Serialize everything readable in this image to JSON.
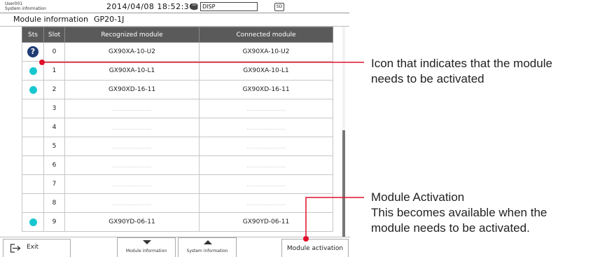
{
  "status_bar": {
    "user": "User001",
    "system_info": "System information",
    "datetime": "2014/04/08  18:52:36",
    "disp": "DISP",
    "sd": "SD"
  },
  "page": {
    "title": "Module information",
    "model": "GP20-1J"
  },
  "table": {
    "headers": {
      "sts": "Sts",
      "slot": "Slot",
      "recognized": "Recognized module",
      "connected": "Connected module"
    },
    "rows": [
      {
        "status": "question",
        "slot": "0",
        "recognized": "GX90XA-10-U2",
        "connected": "GX90XA-10-U2"
      },
      {
        "status": "ok",
        "slot": "1",
        "recognized": "GX90XA-10-L1",
        "connected": "GX90XA-10-L1"
      },
      {
        "status": "ok",
        "slot": "2",
        "recognized": "GX90XD-16-11",
        "connected": "GX90XD-16-11"
      },
      {
        "status": "none",
        "slot": "3",
        "recognized": "…………………",
        "connected": "…………………"
      },
      {
        "status": "none",
        "slot": "4",
        "recognized": "…………………",
        "connected": "…………………"
      },
      {
        "status": "none",
        "slot": "5",
        "recognized": "…………………",
        "connected": "…………………"
      },
      {
        "status": "none",
        "slot": "6",
        "recognized": "…………………",
        "connected": "…………………"
      },
      {
        "status": "none",
        "slot": "7",
        "recognized": "…………………",
        "connected": "…………………"
      },
      {
        "status": "none",
        "slot": "8",
        "recognized": "…………………",
        "connected": "…………………"
      },
      {
        "status": "ok",
        "slot": "9",
        "recognized": "GX90YD-06-11",
        "connected": "GX90YD-06-11"
      }
    ]
  },
  "bottom_bar": {
    "exit_label": "Exit",
    "module_info_label": "Module information",
    "system_info_label": "System information",
    "module_activation_label": "Module activation"
  },
  "annotations": {
    "icon_callout": [
      "Icon that indicates that the module",
      "needs to be activated"
    ],
    "activation_callout": [
      "Module Activation",
      "This becomes available when the",
      "module needs to be activated."
    ]
  },
  "colors": {
    "status_ok": "#17c7d0",
    "question_icon": "#1f3b73",
    "callout_red": "#e0102a",
    "header_bg": "#5a5a5a"
  },
  "icons": {
    "status_question": "question-circle-icon",
    "status_ok": "cyan-dot-icon",
    "exit": "exit-arrow-icon",
    "disk": "disk-icon",
    "sd": "sd-card-icon"
  }
}
